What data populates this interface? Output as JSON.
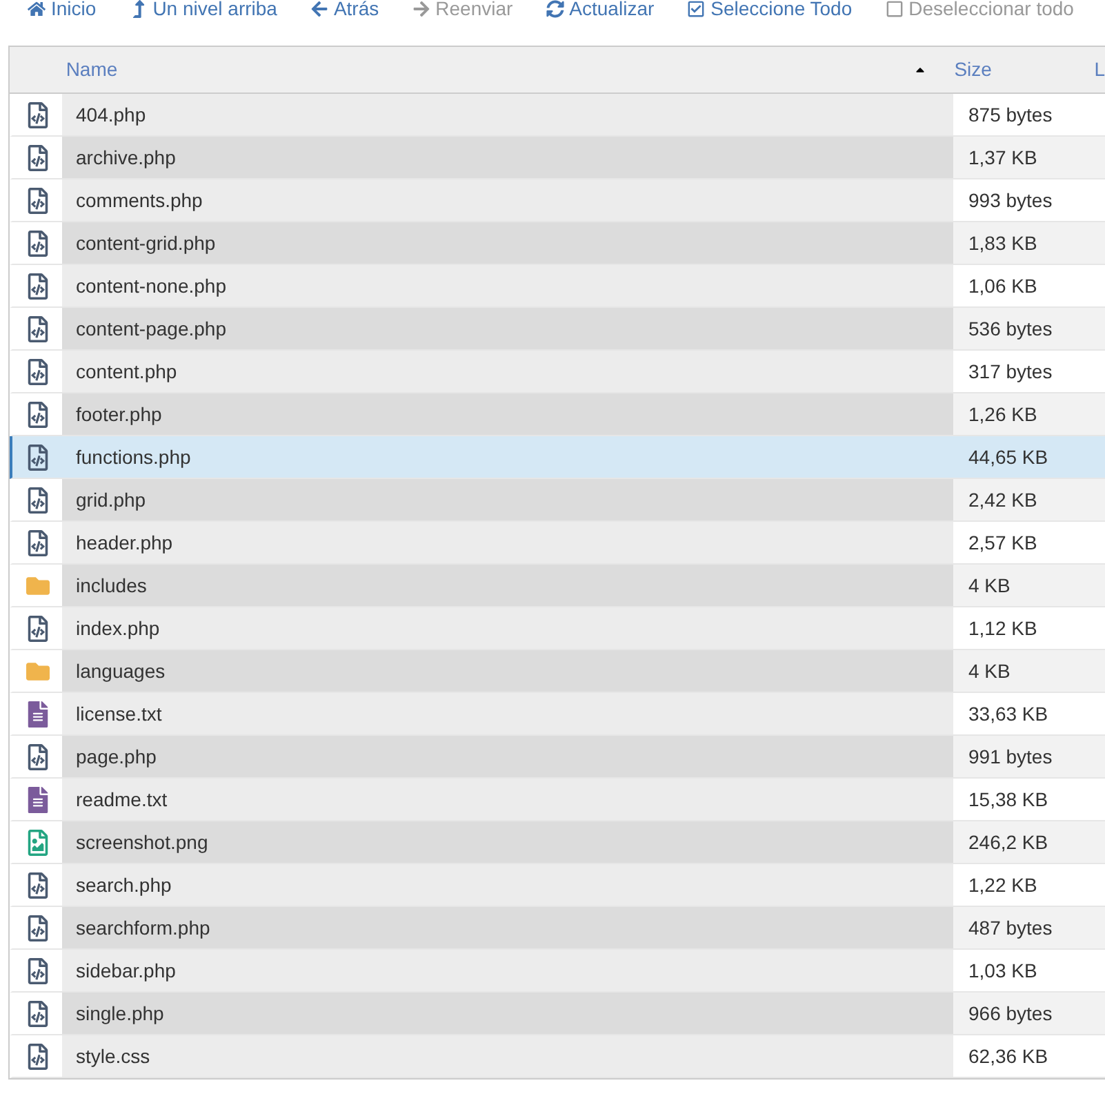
{
  "toolbar": [
    {
      "kind": "home",
      "label": "Inicio",
      "disabled": false
    },
    {
      "kind": "up",
      "label": "Un nivel arriba",
      "disabled": false
    },
    {
      "kind": "back",
      "label": "Atrás",
      "disabled": false
    },
    {
      "kind": "forward",
      "label": "Reenviar",
      "disabled": true
    },
    {
      "kind": "refresh",
      "label": "Actualizar",
      "disabled": false
    },
    {
      "kind": "select-all",
      "label": "Seleccione Todo",
      "disabled": false
    },
    {
      "kind": "deselect",
      "label": "Deseleccionar todo",
      "disabled": true
    }
  ],
  "table": {
    "columns": [
      {
        "label": "Name",
        "sorted": true
      },
      {
        "label": "Size",
        "sorted": false
      },
      {
        "label": "L",
        "sorted": false
      }
    ],
    "rows": [
      {
        "kind": "code",
        "name": "404.php",
        "size": "875 bytes",
        "selected": false
      },
      {
        "kind": "code",
        "name": "archive.php",
        "size": "1,37 KB",
        "selected": false
      },
      {
        "kind": "code",
        "name": "comments.php",
        "size": "993 bytes",
        "selected": false
      },
      {
        "kind": "code",
        "name": "content-grid.php",
        "size": "1,83 KB",
        "selected": false
      },
      {
        "kind": "code",
        "name": "content-none.php",
        "size": "1,06 KB",
        "selected": false
      },
      {
        "kind": "code",
        "name": "content-page.php",
        "size": "536 bytes",
        "selected": false
      },
      {
        "kind": "code",
        "name": "content.php",
        "size": "317 bytes",
        "selected": false
      },
      {
        "kind": "code",
        "name": "footer.php",
        "size": "1,26 KB",
        "selected": false
      },
      {
        "kind": "code",
        "name": "functions.php",
        "size": "44,65 KB",
        "selected": true
      },
      {
        "kind": "code",
        "name": "grid.php",
        "size": "2,42 KB",
        "selected": false
      },
      {
        "kind": "code",
        "name": "header.php",
        "size": "2,57 KB",
        "selected": false
      },
      {
        "kind": "folder",
        "name": "includes",
        "size": "4 KB",
        "selected": false
      },
      {
        "kind": "code",
        "name": "index.php",
        "size": "1,12 KB",
        "selected": false
      },
      {
        "kind": "folder",
        "name": "languages",
        "size": "4 KB",
        "selected": false
      },
      {
        "kind": "text",
        "name": "license.txt",
        "size": "33,63 KB",
        "selected": false
      },
      {
        "kind": "code",
        "name": "page.php",
        "size": "991 bytes",
        "selected": false
      },
      {
        "kind": "text",
        "name": "readme.txt",
        "size": "15,38 KB",
        "selected": false
      },
      {
        "kind": "image",
        "name": "screenshot.png",
        "size": "246,2 KB",
        "selected": false
      },
      {
        "kind": "code",
        "name": "search.php",
        "size": "1,22 KB",
        "selected": false
      },
      {
        "kind": "code",
        "name": "searchform.php",
        "size": "487 bytes",
        "selected": false
      },
      {
        "kind": "code",
        "name": "sidebar.php",
        "size": "1,03 KB",
        "selected": false
      },
      {
        "kind": "code",
        "name": "single.php",
        "size": "966 bytes",
        "selected": false
      },
      {
        "kind": "code",
        "name": "style.css",
        "size": "62,36 KB",
        "selected": false
      }
    ]
  }
}
